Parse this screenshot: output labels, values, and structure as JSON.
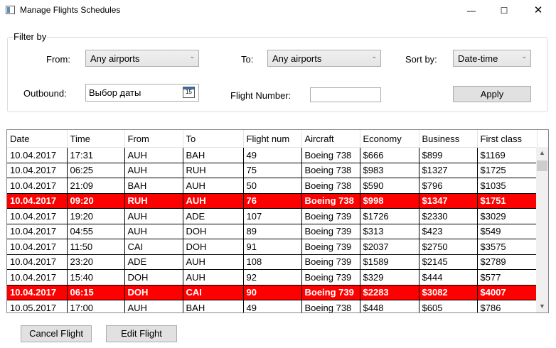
{
  "window": {
    "title": "Manage Flights Schedules",
    "minimize": "—",
    "maximize": "☐",
    "close": "✕"
  },
  "filter": {
    "legend": "Filter by",
    "from_label": "From:",
    "from_value": "Any airports",
    "to_label": "To:",
    "to_value": "Any airports",
    "sort_label": "Sort by:",
    "sort_value": "Date-time",
    "outbound_label": "Outbound:",
    "outbound_placeholder": "Выбор даты",
    "calendar_day": "15",
    "flight_number_label": "Flight Number:",
    "flight_number_value": "",
    "apply_label": "Apply"
  },
  "grid": {
    "columns": [
      "Date",
      "Time",
      "From",
      "To",
      "Flight num",
      "Aircraft",
      "Economy",
      "Business",
      "First class"
    ],
    "rows": [
      {
        "cells": [
          "10.04.2017",
          "17:31",
          "AUH",
          "BAH",
          "49",
          "Boeing 738",
          "$666",
          "$899",
          "$1169"
        ],
        "highlight": false
      },
      {
        "cells": [
          "10.04.2017",
          "06:25",
          "AUH",
          "RUH",
          "75",
          "Boeing 738",
          "$983",
          "$1327",
          "$1725"
        ],
        "highlight": false
      },
      {
        "cells": [
          "10.04.2017",
          "21:09",
          "BAH",
          "AUH",
          "50",
          "Boeing 738",
          "$590",
          "$796",
          "$1035"
        ],
        "highlight": false
      },
      {
        "cells": [
          "10.04.2017",
          "09:20",
          "RUH",
          "AUH",
          "76",
          "Boeing 738",
          "$998",
          "$1347",
          "$1751"
        ],
        "highlight": true
      },
      {
        "cells": [
          "10.04.2017",
          "19:20",
          "AUH",
          "ADE",
          "107",
          "Boeing 739",
          "$1726",
          "$2330",
          "$3029"
        ],
        "highlight": false
      },
      {
        "cells": [
          "10.04.2017",
          "04:55",
          "AUH",
          "DOH",
          "89",
          "Boeing 739",
          "$313",
          "$423",
          "$549"
        ],
        "highlight": false
      },
      {
        "cells": [
          "10.04.2017",
          "11:50",
          "CAI",
          "DOH",
          "91",
          "Boeing 739",
          "$2037",
          "$2750",
          "$3575"
        ],
        "highlight": false
      },
      {
        "cells": [
          "10.04.2017",
          "23:20",
          "ADE",
          "AUH",
          "108",
          "Boeing 739",
          "$1589",
          "$2145",
          "$2789"
        ],
        "highlight": false
      },
      {
        "cells": [
          "10.04.2017",
          "15:40",
          "DOH",
          "AUH",
          "92",
          "Boeing 739",
          "$329",
          "$444",
          "$577"
        ],
        "highlight": false
      },
      {
        "cells": [
          "10.04.2017",
          "06:15",
          "DOH",
          "CAI",
          "90",
          "Boeing 739",
          "$2283",
          "$3082",
          "$4007"
        ],
        "highlight": true
      },
      {
        "cells": [
          "10.05.2017",
          "17:00",
          "AUH",
          "BAH",
          "49",
          "Boeing 738",
          "$448",
          "$605",
          "$786"
        ],
        "highlight": false
      }
    ]
  },
  "actions": {
    "cancel_label": "Cancel Flight",
    "edit_label": "Edit Flight"
  },
  "colors": {
    "highlight_row": "#ff0000",
    "highlight_text": "#ffffff"
  },
  "icons": {
    "app": "window-icon",
    "calendar": "calendar-icon",
    "chevron": "chevron-down-icon"
  }
}
